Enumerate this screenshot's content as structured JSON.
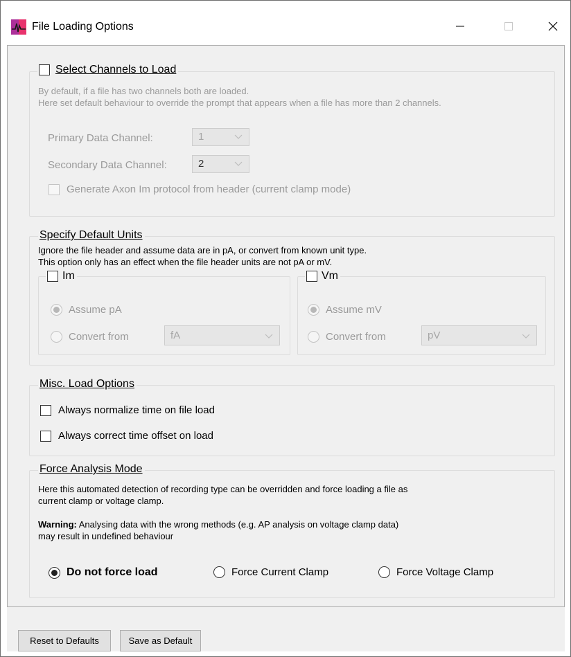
{
  "window": {
    "title": "File Loading Options",
    "icon": "app-waveform-icon",
    "controls": [
      "minimize-icon",
      "maximize-icon",
      "close-icon"
    ]
  },
  "select_channels": {
    "title": "Select Channels to Load",
    "checked": false,
    "desc_line1": "By default, if a file has two channels both are loaded.",
    "desc_line2": "Here set default behaviour to override the prompt that appears when a file has more than 2 channels.",
    "primary_label": "Primary Data Channel:",
    "primary_value": "1",
    "secondary_label": "Secondary Data Channel:",
    "secondary_value": "2",
    "generate_protocol_label": "Generate Axon Im protocol from header (current clamp mode)"
  },
  "default_units": {
    "title": "Specify Default Units",
    "desc_line1": "Ignore the file header and assume data are in pA, or convert from known unit type.",
    "desc_line2": "This option only has an effect when the file header units are not pA or mV.",
    "im": {
      "title": "Im",
      "assume_label": "Assume pA",
      "convert_label": "Convert from",
      "convert_value": "fA"
    },
    "vm": {
      "title": "Vm",
      "assume_label": "Assume mV",
      "convert_label": "Convert from",
      "convert_value": "pV"
    }
  },
  "misc": {
    "title": "Misc. Load Options",
    "normalize_label": "Always normalize time on file load",
    "correct_offset_label": "Always correct time offset on load"
  },
  "force_mode": {
    "title": "Force Analysis Mode",
    "desc_line1": "Here this automated detection of recording type can be overridden and force loading a file as",
    "desc_line2": "current clamp or voltage clamp.",
    "warning_label": "Warning:",
    "warning_text": " Analysing data with the wrong methods (e.g. AP analysis on voltage clamp data)",
    "warning_line2": "may result in undefined behaviour",
    "options": [
      {
        "label": "Do not force load",
        "checked": true
      },
      {
        "label": "Force Current Clamp",
        "checked": false
      },
      {
        "label": "Force Voltage Clamp",
        "checked": false
      }
    ]
  },
  "footer": {
    "reset_label": "Reset to Defaults",
    "save_label": "Save as Default"
  }
}
